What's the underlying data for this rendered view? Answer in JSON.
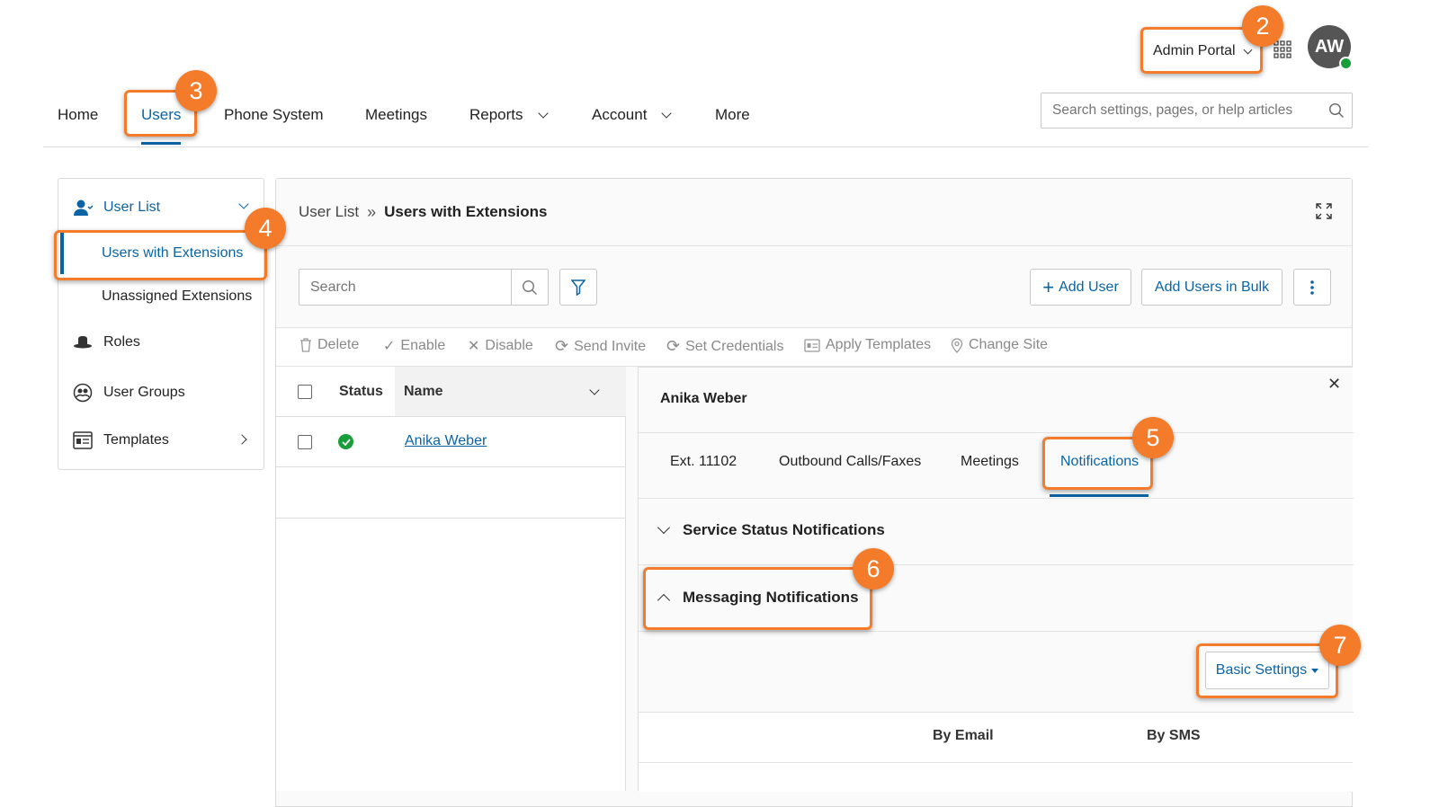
{
  "header": {
    "portal_label": "Admin Portal",
    "avatar_initials": "AW",
    "search_placeholder": "Search settings, pages, or help articles"
  },
  "nav": {
    "items": [
      {
        "label": "Home"
      },
      {
        "label": "Users"
      },
      {
        "label": "Phone System"
      },
      {
        "label": "Meetings"
      },
      {
        "label": "Reports"
      },
      {
        "label": "Account"
      },
      {
        "label": "More"
      }
    ]
  },
  "sidebar": {
    "user_list": "User List",
    "users_with_extensions": "Users with Extensions",
    "unassigned_extensions": "Unassigned Extensions",
    "roles": "Roles",
    "user_groups": "User Groups",
    "templates": "Templates"
  },
  "main": {
    "breadcrumb_parent": "User List",
    "breadcrumb_current": "Users with Extensions",
    "search_placeholder": "Search",
    "add_user": "Add User",
    "add_users_bulk": "Add Users in Bulk",
    "toolbar": {
      "delete": "Delete",
      "enable": "Enable",
      "disable": "Disable",
      "send_invite": "Send Invite",
      "set_credentials": "Set Credentials",
      "apply_templates": "Apply Templates",
      "change_site": "Change Site"
    },
    "table": {
      "col_status": "Status",
      "col_name": "Name",
      "rows": [
        {
          "name": "Anika Weber",
          "status": "active"
        }
      ]
    }
  },
  "detail": {
    "user_name": "Anika Weber",
    "tabs": [
      {
        "label": "Ext. 11102"
      },
      {
        "label": "Outbound Calls/Faxes"
      },
      {
        "label": "Meetings"
      },
      {
        "label": "Notifications"
      }
    ],
    "service_status": "Service Status Notifications",
    "messaging": "Messaging Notifications",
    "basic_settings": "Basic Settings",
    "col_email": "By Email",
    "col_sms": "By SMS"
  },
  "callouts": [
    "2",
    "3",
    "4",
    "5",
    "6",
    "7"
  ],
  "colors": {
    "accent": "#0a64a4",
    "callout": "#f47b2a",
    "status_ok": "#1a9e3a"
  }
}
